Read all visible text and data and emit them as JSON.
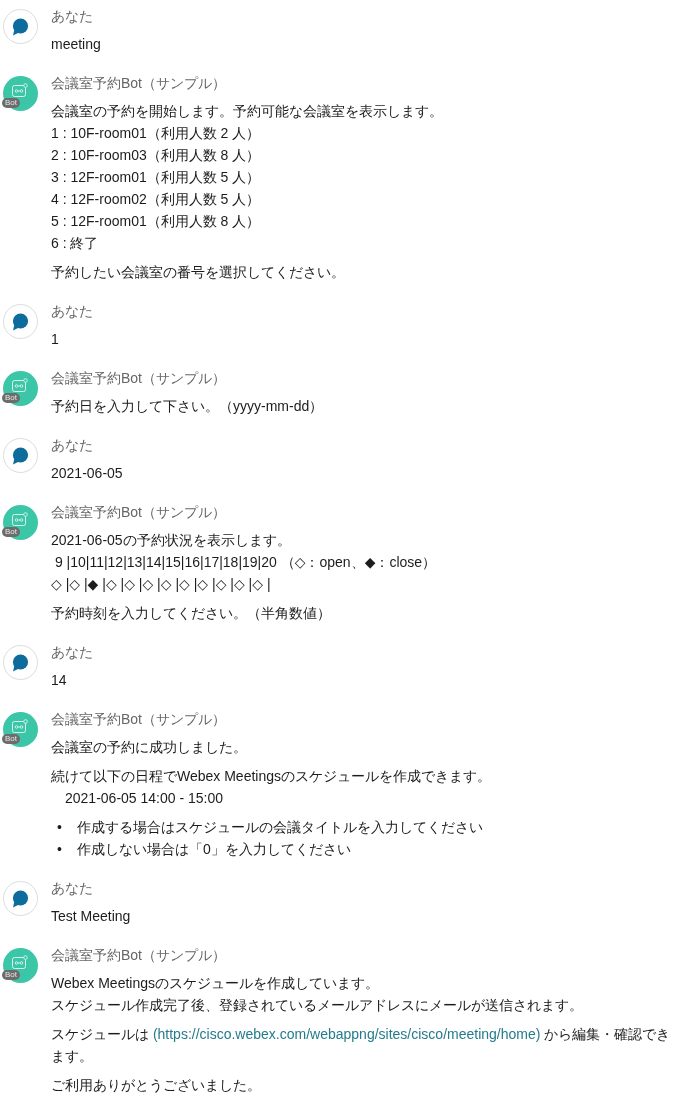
{
  "messages": [
    {
      "kind": "user",
      "sender": "あなた",
      "blocks": [
        {
          "kind": "text",
          "lines": [
            "meeting"
          ]
        }
      ]
    },
    {
      "kind": "bot",
      "sender": "会議室予約Bot（サンプル）",
      "badge": "Bot",
      "blocks": [
        {
          "kind": "text",
          "lines": [
            "会議室の予約を開始します。予約可能な会議室を表示します。",
            "1 : 10F-room01（利用人数 2 人）",
            "2 : 10F-room03（利用人数 8 人）",
            "3 : 12F-room01（利用人数 5 人）",
            "4 : 12F-room02（利用人数 5 人）",
            "5 : 12F-room01（利用人数 8 人）",
            "6 : 終了"
          ]
        },
        {
          "kind": "text",
          "lines": [
            "予約したい会議室の番号を選択してください。"
          ]
        }
      ]
    },
    {
      "kind": "user",
      "sender": "あなた",
      "blocks": [
        {
          "kind": "text",
          "lines": [
            "1"
          ]
        }
      ]
    },
    {
      "kind": "bot",
      "sender": "会議室予約Bot（サンプル）",
      "badge": "Bot",
      "blocks": [
        {
          "kind": "text",
          "lines": [
            "予約日を入力して下さい。（yyyy-mm-dd）"
          ]
        }
      ]
    },
    {
      "kind": "user",
      "sender": "あなた",
      "blocks": [
        {
          "kind": "text",
          "lines": [
            "2021-06-05"
          ]
        }
      ]
    },
    {
      "kind": "bot",
      "sender": "会議室予約Bot（サンプル）",
      "badge": "Bot",
      "blocks": [
        {
          "kind": "text",
          "lines": [
            "2021-06-05の予約状況を表示します。",
            " 9 |10|11|12|13|14|15|16|17|18|19|20 （◇：open、◆：close）",
            "◇ |◇ |◆ |◇ |◇ |◇ |◇ |◇ |◇ |◇ |◇ |◇ |"
          ]
        },
        {
          "kind": "text",
          "lines": [
            "予約時刻を入力してください。（半角数値）"
          ]
        }
      ]
    },
    {
      "kind": "user",
      "sender": "あなた",
      "blocks": [
        {
          "kind": "text",
          "lines": [
            "14"
          ]
        }
      ]
    },
    {
      "kind": "bot",
      "sender": "会議室予約Bot（サンプル）",
      "badge": "Bot",
      "blocks": [
        {
          "kind": "text",
          "lines": [
            "会議室の予約に成功しました。"
          ]
        },
        {
          "kind": "text",
          "lines": [
            "続けて以下の日程でWebex Meetingsのスケジュールを作成できます。"
          ]
        },
        {
          "kind": "indented",
          "lines": [
            "2021-06-05 14:00 - 15:00"
          ]
        },
        {
          "kind": "bullets",
          "items": [
            {
              "bullet": "•",
              "text": "作成する場合はスケジュールの会議タイトルを入力してください"
            },
            {
              "bullet": "•",
              "text": "作成しない場合は「0」を入力してください"
            }
          ]
        }
      ]
    },
    {
      "kind": "user",
      "sender": "あなた",
      "blocks": [
        {
          "kind": "text",
          "lines": [
            "Test Meeting"
          ]
        }
      ]
    },
    {
      "kind": "bot",
      "sender": "会議室予約Bot（サンプル）",
      "badge": "Bot",
      "blocks": [
        {
          "kind": "text",
          "lines": [
            "Webex Meetingsのスケジュールを作成しています。",
            "スケジュール作成完了後、登録されているメールアドレスにメールが送信されます。"
          ]
        },
        {
          "kind": "link_text",
          "before": "スケジュールは ",
          "link": "(https://cisco.webex.com/webappng/sites/cisco/meeting/home)",
          "after": " から編集・確認できます。"
        },
        {
          "kind": "text",
          "lines": [
            "ご利用ありがとうございました。"
          ]
        }
      ]
    }
  ]
}
